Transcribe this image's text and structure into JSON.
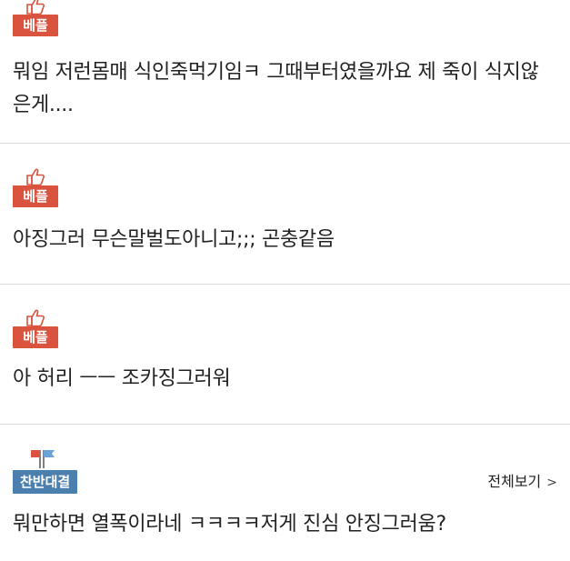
{
  "comments": [
    {
      "badge": "베플",
      "text": "뭐임 저런몸매 식인죽먹기임ㅋ 그때부터였을까요 제 죽이 식지않은게...."
    },
    {
      "badge": "베플",
      "text": "아징그러 무슨말벌도아니고;;; 곤충같음"
    },
    {
      "badge": "베플",
      "text": "아 허리 ㅡㅡ 조카징그러워"
    }
  ],
  "debate": {
    "badge": "찬반대결",
    "view_all": "전체보기",
    "view_all_icon": "chevron-right-icon",
    "text": "뭐만하면 열폭이라네 ㅋㅋㅋㅋ저게 진심 안징그러움?"
  },
  "colors": {
    "best_badge": "#d9533e",
    "debate_badge": "#4b7fad",
    "divider": "#dcdcdc"
  }
}
